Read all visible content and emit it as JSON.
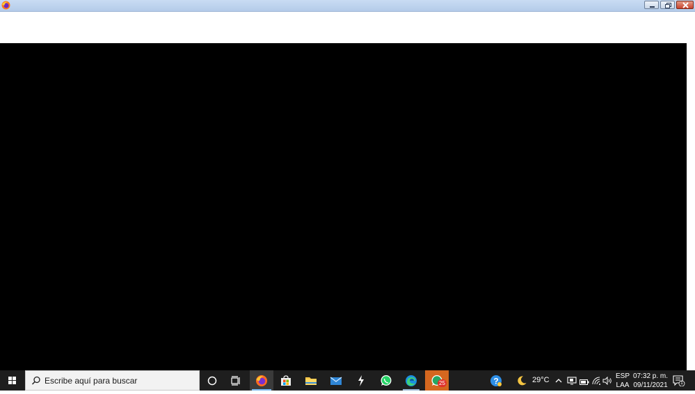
{
  "taskbar": {
    "search_placeholder": "Escribe aquí para buscar",
    "weather": {
      "temperature": "29°C",
      "icon": "moon-icon"
    },
    "language": {
      "line1": "ESP",
      "line2": "LAA"
    },
    "clock": {
      "time": "07:32 p. m.",
      "date": "09/11/2021"
    },
    "whatsapp_badge": "25",
    "notification_count": "1",
    "apps": [
      "cortana-icon",
      "task-view-icon",
      "firefox-icon",
      "store-icon",
      "file-explorer-icon",
      "mail-icon",
      "lightning-app-icon",
      "whatsapp-icon",
      "edge-icon",
      "whatsapp-business-icon"
    ]
  },
  "colors": {
    "titlebar": "#b4cbe9",
    "taskbar": "#1e1e1e",
    "content": "#000000",
    "active_underline": "#79b8ef",
    "whatsapp_highlight": "#d4671f"
  }
}
